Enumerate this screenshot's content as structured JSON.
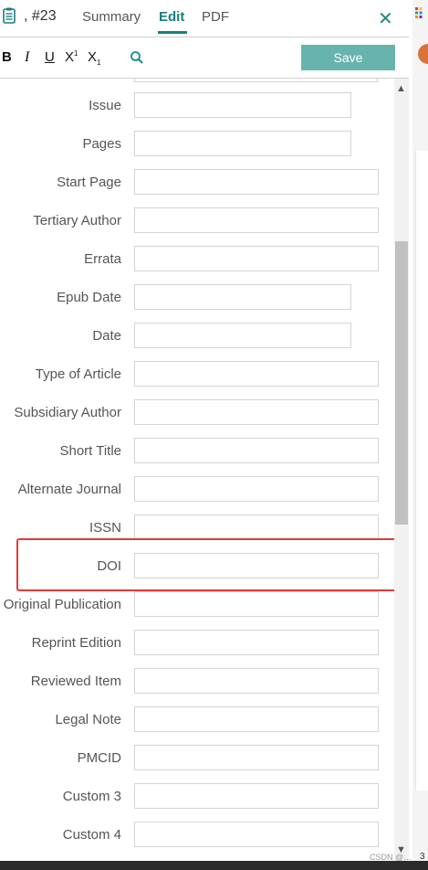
{
  "header": {
    "reference": ", #23",
    "tabs": [
      {
        "label": "Summary",
        "active": false
      },
      {
        "label": "Edit",
        "active": true
      },
      {
        "label": "PDF",
        "active": false
      }
    ],
    "accent_color": "#1a7f7a"
  },
  "toolbar": {
    "bold": "B",
    "italic": "I",
    "underline": "U",
    "superscript": "X",
    "superscript_mark": "1",
    "subscript": "X",
    "subscript_mark": "1",
    "save_label": "Save",
    "save_color": "#67b4ae"
  },
  "fields": [
    {
      "label": "Issue",
      "value": ""
    },
    {
      "label": "Pages",
      "value": ""
    },
    {
      "label": "Start Page",
      "value": ""
    },
    {
      "label": "Tertiary Author",
      "value": ""
    },
    {
      "label": "Errata",
      "value": ""
    },
    {
      "label": "Epub Date",
      "value": ""
    },
    {
      "label": "Date",
      "value": ""
    },
    {
      "label": "Type of Article",
      "value": ""
    },
    {
      "label": "Subsidiary Author",
      "value": ""
    },
    {
      "label": "Short Title",
      "value": ""
    },
    {
      "label": "Alternate Journal",
      "value": ""
    },
    {
      "label": "ISSN",
      "value": ""
    },
    {
      "label": "DOI",
      "value": ""
    },
    {
      "label": "Original Publication",
      "value": ""
    },
    {
      "label": "Reprint Edition",
      "value": ""
    },
    {
      "label": "Reviewed Item",
      "value": ""
    },
    {
      "label": "Legal Note",
      "value": ""
    },
    {
      "label": "PMCID",
      "value": ""
    },
    {
      "label": "Custom 3",
      "value": ""
    },
    {
      "label": "Custom 4",
      "value": ""
    }
  ],
  "highlight_color": "#e53935",
  "right_edge": {
    "number": "3"
  },
  "watermark": "CSDN @…"
}
